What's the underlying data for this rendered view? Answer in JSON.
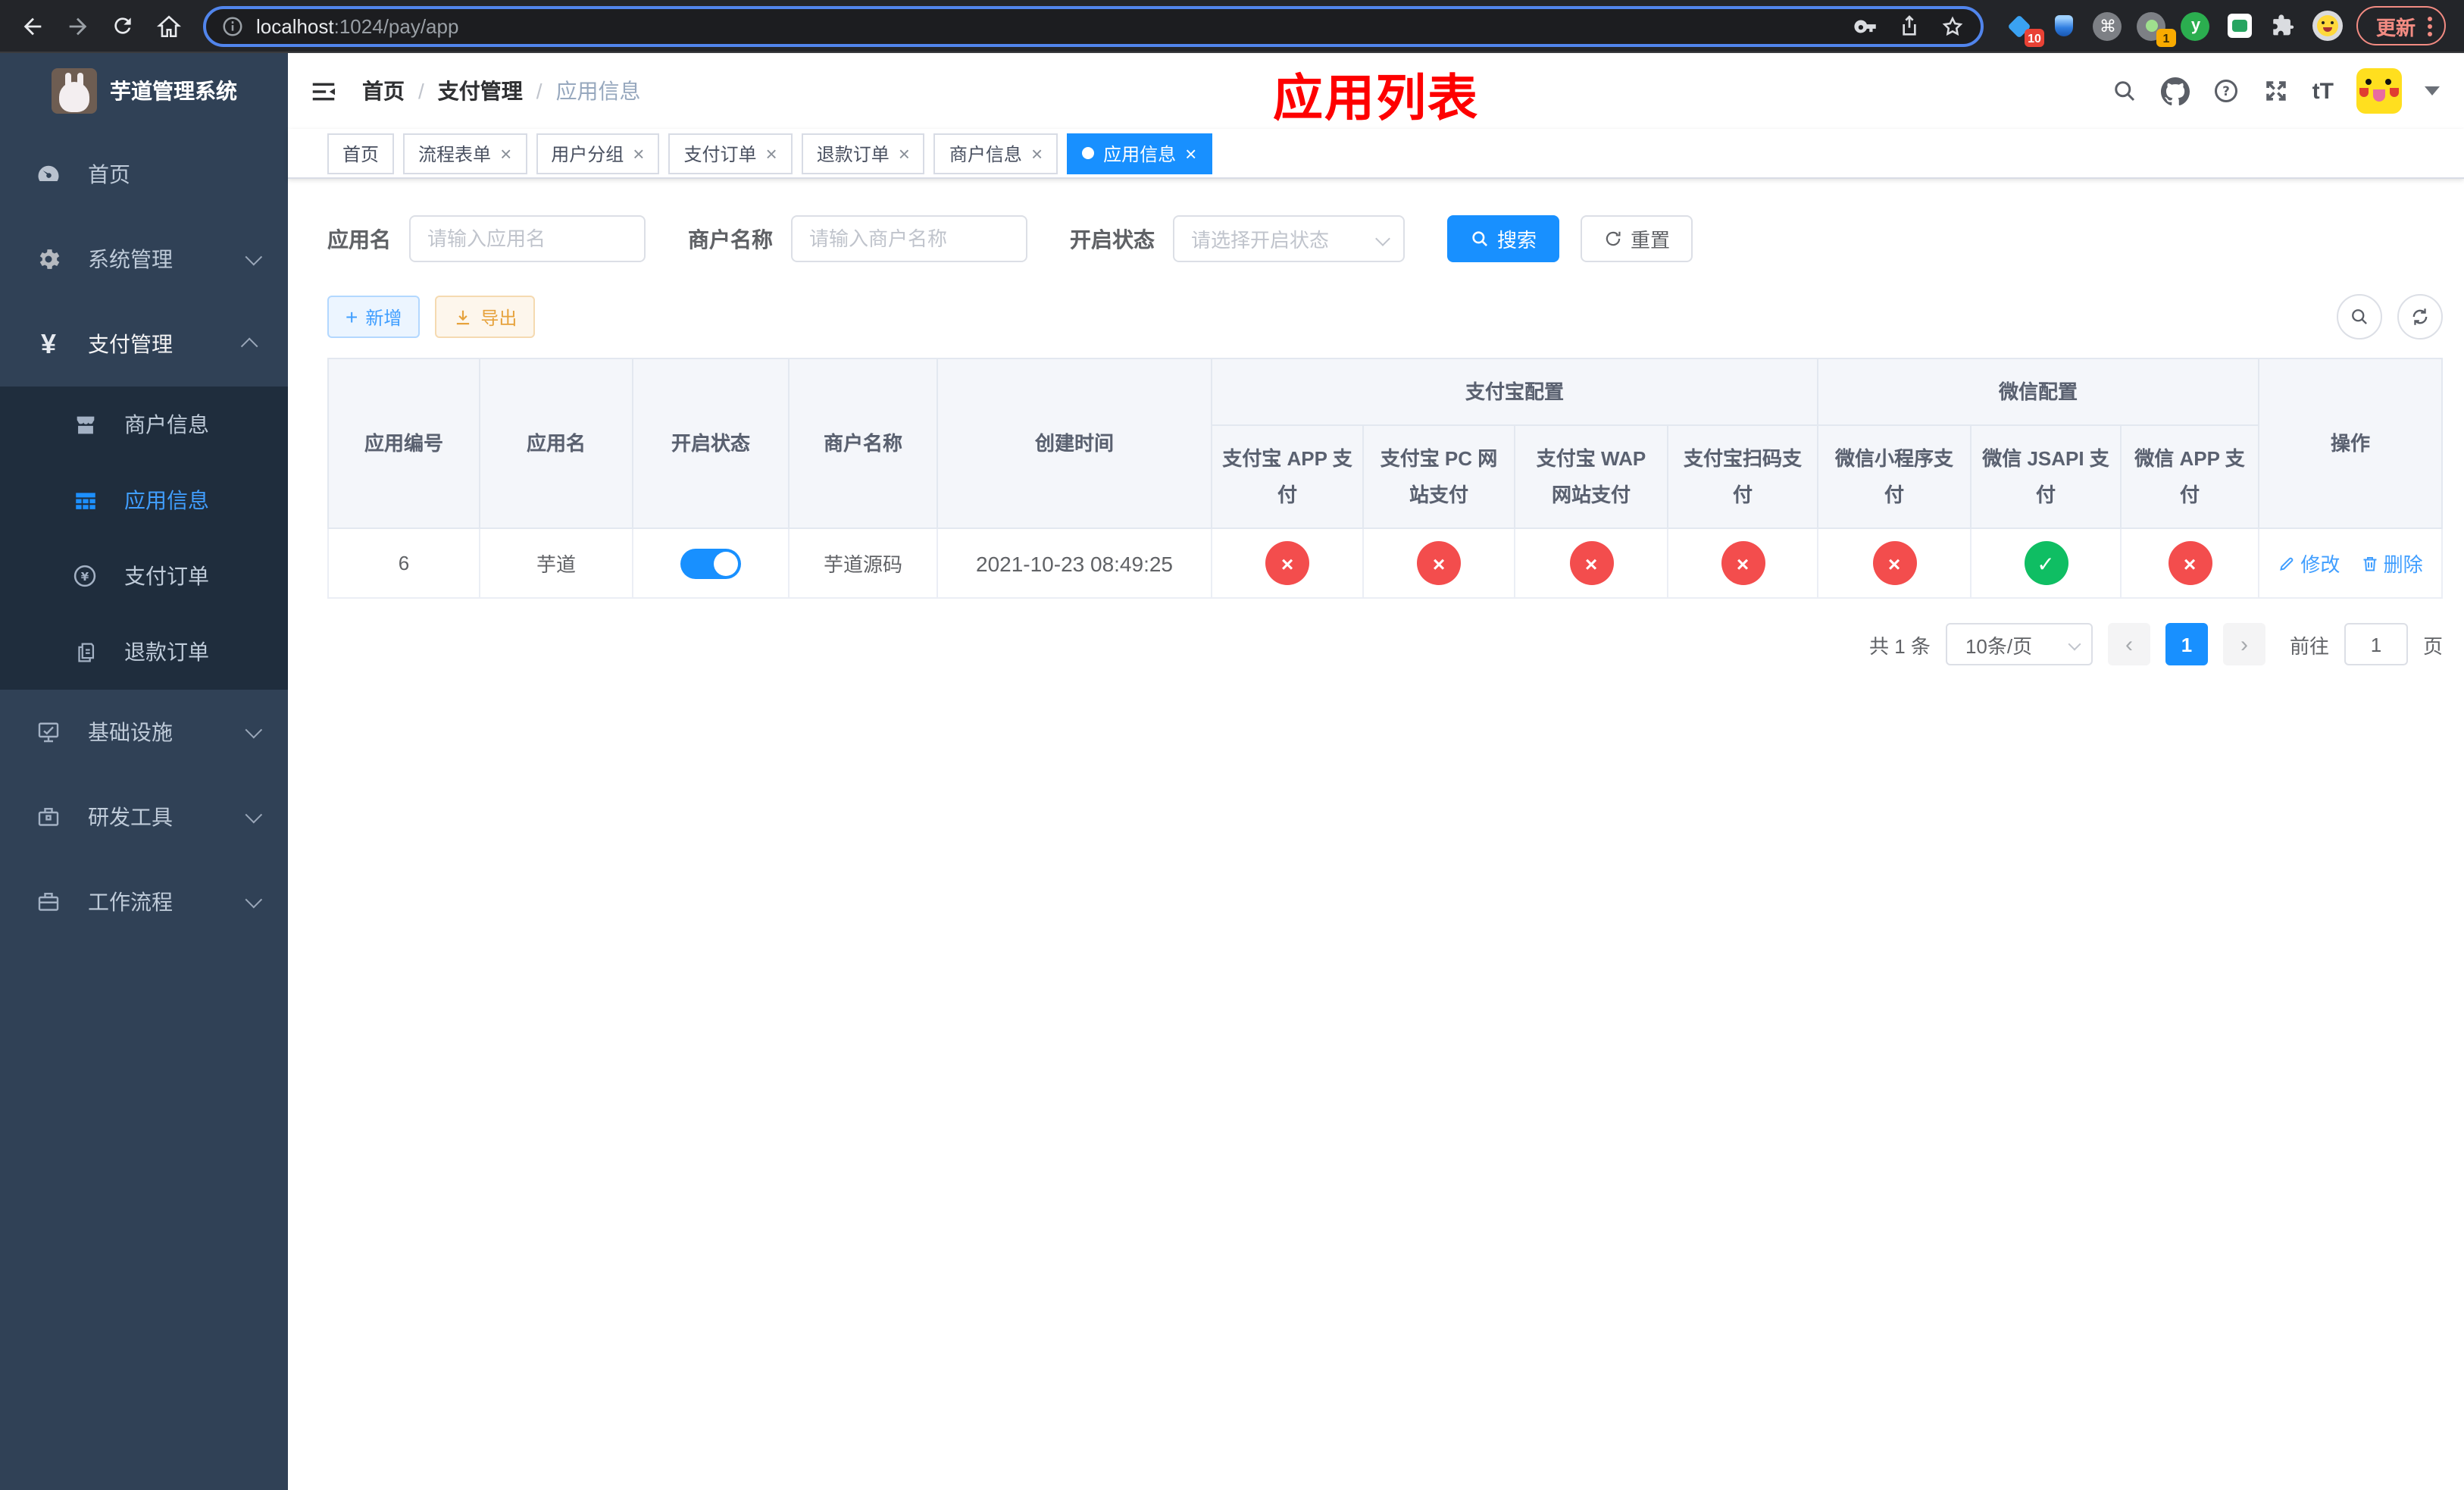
{
  "browser": {
    "url_host": "localhost",
    "url_rest": ":1024/pay/app",
    "update_label": "更新",
    "ext_badge_pin": "10",
    "ext_badge_status": "1",
    "ext_y_label": "y"
  },
  "glyphs": {
    "close": "×",
    "slash": "/",
    "yen": "¥",
    "plus": "+",
    "question": "?",
    "font_size": "tT",
    "prev": "‹",
    "next": "›",
    "command": "⌘"
  },
  "sidebar": {
    "title": "芋道管理系统",
    "items": [
      {
        "label": "首页"
      },
      {
        "label": "系统管理"
      },
      {
        "label": "支付管理"
      },
      {
        "label": "基础设施"
      },
      {
        "label": "研发工具"
      },
      {
        "label": "工作流程"
      }
    ],
    "submenu": [
      {
        "label": "商户信息"
      },
      {
        "label": "应用信息"
      },
      {
        "label": "支付订单"
      },
      {
        "label": "退款订单"
      }
    ]
  },
  "header": {
    "breadcrumb": [
      "首页",
      "支付管理",
      "应用信息"
    ],
    "annotation": "应用列表"
  },
  "tabs": [
    {
      "label": "首页"
    },
    {
      "label": "流程表单"
    },
    {
      "label": "用户分组"
    },
    {
      "label": "支付订单"
    },
    {
      "label": "退款订单"
    },
    {
      "label": "商户信息"
    },
    {
      "label": "应用信息"
    }
  ],
  "filters": {
    "app_name_label": "应用名",
    "app_name_placeholder": "请输入应用名",
    "merchant_label": "商户名称",
    "merchant_placeholder": "请输入商户名称",
    "status_label": "开启状态",
    "status_placeholder": "请选择开启状态",
    "search_label": "搜索",
    "reset_label": "重置"
  },
  "toolbar": {
    "add_label": "新增",
    "export_label": "导出"
  },
  "table": {
    "group_headers": {
      "alipay": "支付宝配置",
      "wechat": "微信配置"
    },
    "headers": {
      "id": "应用编号",
      "name": "应用名",
      "status": "开启状态",
      "merchant": "商户名称",
      "created": "创建时间",
      "alipay_app": "支付宝 APP 支付",
      "alipay_pc": "支付宝 PC 网站支付",
      "alipay_wap": "支付宝 WAP 网站支付",
      "alipay_qr": "支付宝扫码支付",
      "wx_mini": "微信小程序支付",
      "wx_jsapi": "微信 JSAPI 支付",
      "wx_app": "微信 APP 支付",
      "actions": "操作"
    },
    "rows": [
      {
        "id": "6",
        "name": "芋道",
        "enabled": true,
        "merchant": "芋道源码",
        "created": "2021-10-23 08:49:25",
        "configs": [
          {
            "name": "alipay-app-pay",
            "state": "fail",
            "glyph": "×",
            "style": "background:#f34d4d"
          },
          {
            "name": "alipay-pc-pay",
            "state": "fail",
            "glyph": "×",
            "style": "background:#f34d4d"
          },
          {
            "name": "alipay-wap-pay",
            "state": "fail",
            "glyph": "×",
            "style": "background:#f34d4d"
          },
          {
            "name": "alipay-qr-pay",
            "state": "fail",
            "glyph": "×",
            "style": "background:#f34d4d"
          },
          {
            "name": "wechat-mini-pay",
            "state": "fail",
            "glyph": "×",
            "style": "background:#f34d4d"
          },
          {
            "name": "wechat-jsapi-pay",
            "state": "pass",
            "glyph": "✓",
            "style": "background:#0fbe63"
          },
          {
            "name": "wechat-app-pay",
            "state": "fail",
            "glyph": "×",
            "style": "background:#f34d4d"
          }
        ],
        "actions": {
          "edit": "修改",
          "delete": "删除"
        }
      }
    ]
  },
  "pagination": {
    "total": "共 1 条",
    "page_size": "10条/页",
    "current_page": "1",
    "goto_label": "前往",
    "goto_value": "1",
    "page_unit": "页"
  },
  "colors": {
    "primary": "#1890ff",
    "link": "#409eff",
    "pass": "#0fbe63",
    "fail": "#f34d4d",
    "annotation": "#fe0000",
    "sidebar_bg": "#304156",
    "submenu_bg": "#1f2d3d"
  }
}
